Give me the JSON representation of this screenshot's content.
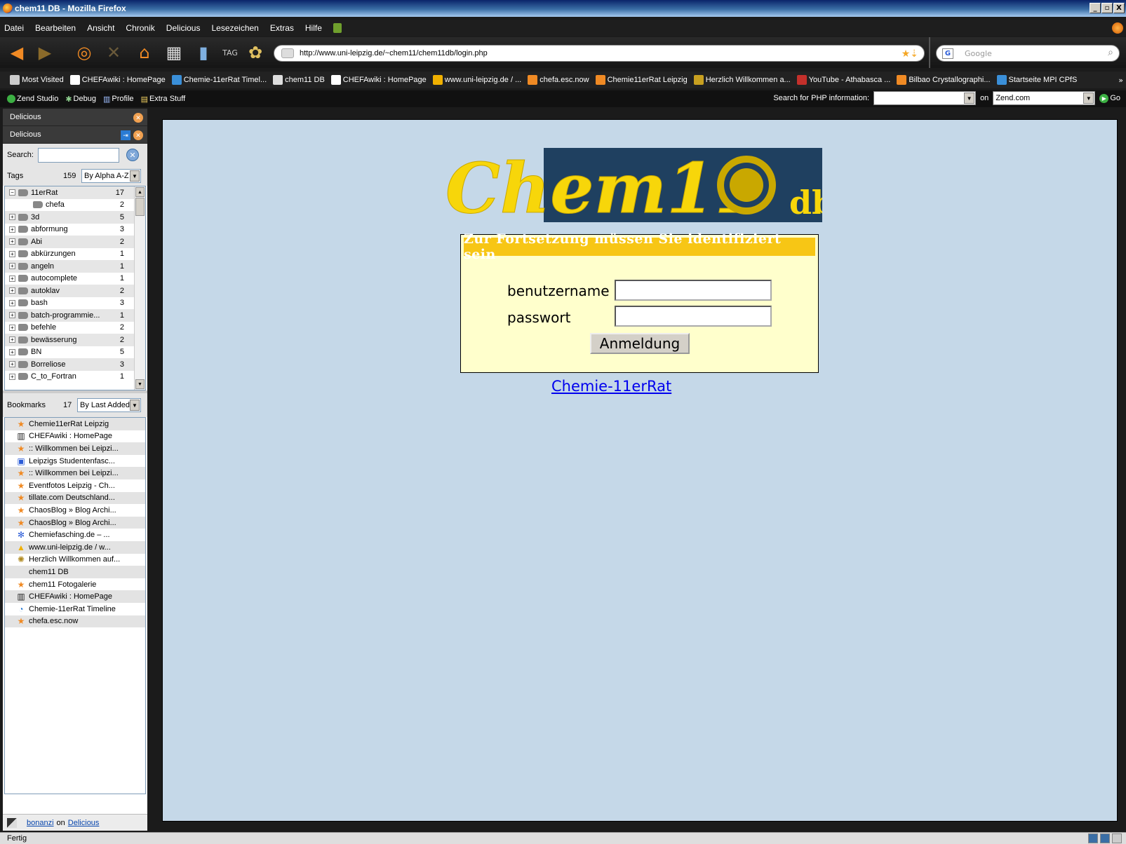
{
  "window": {
    "title": "chem11 DB - Mozilla Firefox",
    "controls": [
      "_",
      "▫",
      "X"
    ]
  },
  "menu": [
    {
      "label": "Datei",
      "accel": "D"
    },
    {
      "label": "Bearbeiten",
      "accel": "B"
    },
    {
      "label": "Ansicht",
      "accel": "A"
    },
    {
      "label": "Chronik",
      "accel": "C"
    },
    {
      "label": "Delicious",
      "accel": ""
    },
    {
      "label": "Lesezeichen",
      "accel": "L"
    },
    {
      "label": "Extras",
      "accel": "E"
    },
    {
      "label": "Hilfe",
      "accel": "H"
    }
  ],
  "nav": {
    "url": "http://www.uni-leipzig.de/~chem11/chem11db/login.php",
    "search_placeholder": "Google"
  },
  "bookmarks_toolbar": [
    {
      "label": "Most Visited",
      "icon": "most-visited-icon",
      "color": "#cccccc"
    },
    {
      "label": "CHEFAwiki : HomePage",
      "icon": "wiki-icon",
      "color": "#ffffff"
    },
    {
      "label": "Chemie-11erRat Timel...",
      "icon": "timeline-icon",
      "color": "#3a8fd8"
    },
    {
      "label": "chem11 DB",
      "icon": "page-icon",
      "color": "#dddddd"
    },
    {
      "label": "CHEFAwiki : HomePage",
      "icon": "wiki-icon",
      "color": "#ffffff"
    },
    {
      "label": "www.uni-leipzig.de / ...",
      "icon": "pma-icon",
      "color": "#f0b000"
    },
    {
      "label": "chefa.esc.now",
      "icon": "star-icon",
      "color": "#f08a24"
    },
    {
      "label": "Chemie11erRat Leipzig",
      "icon": "star-icon",
      "color": "#f08a24"
    },
    {
      "label": "Herzlich Willkommen a...",
      "icon": "emblem-icon",
      "color": "#c8a020"
    },
    {
      "label": "YouTube - Athabasca ...",
      "icon": "youtube-icon",
      "color": "#c4302b"
    },
    {
      "label": "Bilbao Crystallographi...",
      "icon": "star-icon",
      "color": "#f08a24"
    },
    {
      "label": "Startseite MPI CPfS",
      "icon": "globe-icon",
      "color": "#3a8fd8"
    }
  ],
  "zend": {
    "items": [
      "Zend Studio",
      "Debug",
      "Profile",
      "Extra Stuff"
    ],
    "search_label": "Search for PHP information:",
    "search_value": "",
    "on_label": "on",
    "site": "Zend.com",
    "go": "Go"
  },
  "sidebar": {
    "panel_title": "Delicious",
    "sub_title": "Delicious",
    "search_label": "Search:",
    "search_value": "",
    "tags_label": "Tags",
    "tags_count": "159",
    "tags_sort": "By Alpha A-Z",
    "tags": [
      {
        "name": "11erRat",
        "count": "17",
        "expanded": true
      },
      {
        "name": "chefa",
        "count": "2",
        "child": true
      },
      {
        "name": "3d",
        "count": "5"
      },
      {
        "name": "abformung",
        "count": "3"
      },
      {
        "name": "Abi",
        "count": "2"
      },
      {
        "name": "abkürzungen",
        "count": "1"
      },
      {
        "name": "angeln",
        "count": "1"
      },
      {
        "name": "autocomplete",
        "count": "1"
      },
      {
        "name": "autoklav",
        "count": "2"
      },
      {
        "name": "bash",
        "count": "3"
      },
      {
        "name": "batch-programmie...",
        "count": "1"
      },
      {
        "name": "befehle",
        "count": "2"
      },
      {
        "name": "bewässerung",
        "count": "2"
      },
      {
        "name": "BN",
        "count": "5"
      },
      {
        "name": "Borreliose",
        "count": "3"
      },
      {
        "name": "C_to_Fortran",
        "count": "1"
      }
    ],
    "bookmarks_label": "Bookmarks",
    "bookmarks_count": "17",
    "bookmarks_sort": "By Last Added",
    "bookmarks": [
      {
        "label": "Chemie11erRat Leipzig",
        "icon": "star-icon"
      },
      {
        "label": "CHEFAwiki : HomePage",
        "icon": "wiki-icon"
      },
      {
        "label": ":: Willkommen bei Leipzi...",
        "icon": "star-icon"
      },
      {
        "label": "Leipzigs Studentenfasc...",
        "icon": "lvz-icon"
      },
      {
        "label": ":: Willkommen bei Leipzi...",
        "icon": "star-icon"
      },
      {
        "label": "Eventfotos Leipzig - Ch...",
        "icon": "star-icon"
      },
      {
        "label": "tillate.com Deutschland...",
        "icon": "star-icon"
      },
      {
        "label": "ChaosBlog » Blog Archi...",
        "icon": "star-icon"
      },
      {
        "label": "ChaosBlog » Blog Archi...",
        "icon": "star-icon"
      },
      {
        "label": "Chemiefasching.de – ...",
        "icon": "molecule-icon"
      },
      {
        "label": "www.uni-leipzig.de / w...",
        "icon": "pma-icon"
      },
      {
        "label": "Herzlich Willkommen auf...",
        "icon": "emblem-icon"
      },
      {
        "label": "chem11 DB",
        "icon": "blank-icon"
      },
      {
        "label": "chem11 Fotogalerie",
        "icon": "star-icon"
      },
      {
        "label": "CHEFAwiki : HomePage",
        "icon": "wiki-icon"
      },
      {
        "label": "Chemie-11erRat Timeline",
        "icon": "timeline-icon"
      },
      {
        "label": "chefa.esc.now",
        "icon": "star-icon"
      }
    ],
    "footer_user": "bonanzi",
    "footer_on": "on",
    "footer_service": "Delicious"
  },
  "page": {
    "logo_alt": "Chem11 db",
    "logo_text": "Chem11",
    "logo_side_text": "db",
    "login_header": "Zur Fortsetzung müssen Sie identifiziert sein",
    "username_label": "benutzername",
    "password_label": "passwort",
    "username_value": "",
    "password_value": "",
    "submit_label": "Anmeldung",
    "footer_link": "Chemie-11erRat",
    "accent": "#f7c615",
    "background": "#c5d8e8"
  },
  "status": {
    "text": "Fertig"
  }
}
